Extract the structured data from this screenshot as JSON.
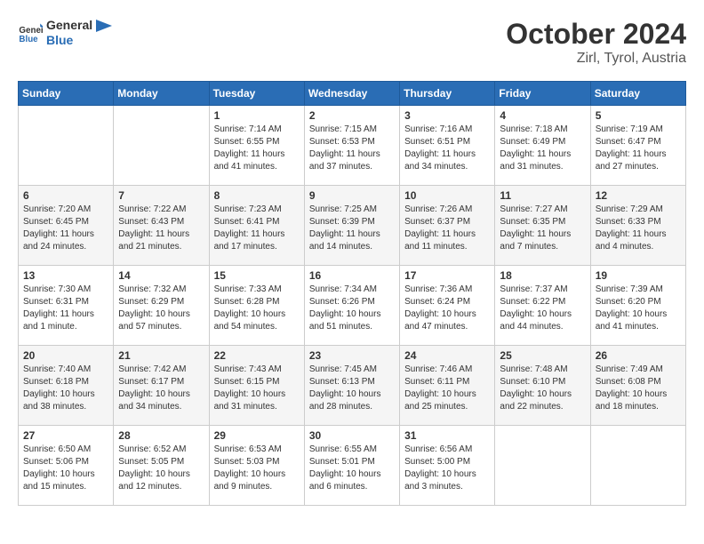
{
  "logo": {
    "line1": "General",
    "line2": "Blue"
  },
  "title": "October 2024",
  "subtitle": "Zirl, Tyrol, Austria",
  "header_days": [
    "Sunday",
    "Monday",
    "Tuesday",
    "Wednesday",
    "Thursday",
    "Friday",
    "Saturday"
  ],
  "weeks": [
    [
      {
        "day": "",
        "info": ""
      },
      {
        "day": "",
        "info": ""
      },
      {
        "day": "1",
        "info": "Sunrise: 7:14 AM\nSunset: 6:55 PM\nDaylight: 11 hours and 41 minutes."
      },
      {
        "day": "2",
        "info": "Sunrise: 7:15 AM\nSunset: 6:53 PM\nDaylight: 11 hours and 37 minutes."
      },
      {
        "day": "3",
        "info": "Sunrise: 7:16 AM\nSunset: 6:51 PM\nDaylight: 11 hours and 34 minutes."
      },
      {
        "day": "4",
        "info": "Sunrise: 7:18 AM\nSunset: 6:49 PM\nDaylight: 11 hours and 31 minutes."
      },
      {
        "day": "5",
        "info": "Sunrise: 7:19 AM\nSunset: 6:47 PM\nDaylight: 11 hours and 27 minutes."
      }
    ],
    [
      {
        "day": "6",
        "info": "Sunrise: 7:20 AM\nSunset: 6:45 PM\nDaylight: 11 hours and 24 minutes."
      },
      {
        "day": "7",
        "info": "Sunrise: 7:22 AM\nSunset: 6:43 PM\nDaylight: 11 hours and 21 minutes."
      },
      {
        "day": "8",
        "info": "Sunrise: 7:23 AM\nSunset: 6:41 PM\nDaylight: 11 hours and 17 minutes."
      },
      {
        "day": "9",
        "info": "Sunrise: 7:25 AM\nSunset: 6:39 PM\nDaylight: 11 hours and 14 minutes."
      },
      {
        "day": "10",
        "info": "Sunrise: 7:26 AM\nSunset: 6:37 PM\nDaylight: 11 hours and 11 minutes."
      },
      {
        "day": "11",
        "info": "Sunrise: 7:27 AM\nSunset: 6:35 PM\nDaylight: 11 hours and 7 minutes."
      },
      {
        "day": "12",
        "info": "Sunrise: 7:29 AM\nSunset: 6:33 PM\nDaylight: 11 hours and 4 minutes."
      }
    ],
    [
      {
        "day": "13",
        "info": "Sunrise: 7:30 AM\nSunset: 6:31 PM\nDaylight: 11 hours and 1 minute."
      },
      {
        "day": "14",
        "info": "Sunrise: 7:32 AM\nSunset: 6:29 PM\nDaylight: 10 hours and 57 minutes."
      },
      {
        "day": "15",
        "info": "Sunrise: 7:33 AM\nSunset: 6:28 PM\nDaylight: 10 hours and 54 minutes."
      },
      {
        "day": "16",
        "info": "Sunrise: 7:34 AM\nSunset: 6:26 PM\nDaylight: 10 hours and 51 minutes."
      },
      {
        "day": "17",
        "info": "Sunrise: 7:36 AM\nSunset: 6:24 PM\nDaylight: 10 hours and 47 minutes."
      },
      {
        "day": "18",
        "info": "Sunrise: 7:37 AM\nSunset: 6:22 PM\nDaylight: 10 hours and 44 minutes."
      },
      {
        "day": "19",
        "info": "Sunrise: 7:39 AM\nSunset: 6:20 PM\nDaylight: 10 hours and 41 minutes."
      }
    ],
    [
      {
        "day": "20",
        "info": "Sunrise: 7:40 AM\nSunset: 6:18 PM\nDaylight: 10 hours and 38 minutes."
      },
      {
        "day": "21",
        "info": "Sunrise: 7:42 AM\nSunset: 6:17 PM\nDaylight: 10 hours and 34 minutes."
      },
      {
        "day": "22",
        "info": "Sunrise: 7:43 AM\nSunset: 6:15 PM\nDaylight: 10 hours and 31 minutes."
      },
      {
        "day": "23",
        "info": "Sunrise: 7:45 AM\nSunset: 6:13 PM\nDaylight: 10 hours and 28 minutes."
      },
      {
        "day": "24",
        "info": "Sunrise: 7:46 AM\nSunset: 6:11 PM\nDaylight: 10 hours and 25 minutes."
      },
      {
        "day": "25",
        "info": "Sunrise: 7:48 AM\nSunset: 6:10 PM\nDaylight: 10 hours and 22 minutes."
      },
      {
        "day": "26",
        "info": "Sunrise: 7:49 AM\nSunset: 6:08 PM\nDaylight: 10 hours and 18 minutes."
      }
    ],
    [
      {
        "day": "27",
        "info": "Sunrise: 6:50 AM\nSunset: 5:06 PM\nDaylight: 10 hours and 15 minutes."
      },
      {
        "day": "28",
        "info": "Sunrise: 6:52 AM\nSunset: 5:05 PM\nDaylight: 10 hours and 12 minutes."
      },
      {
        "day": "29",
        "info": "Sunrise: 6:53 AM\nSunset: 5:03 PM\nDaylight: 10 hours and 9 minutes."
      },
      {
        "day": "30",
        "info": "Sunrise: 6:55 AM\nSunset: 5:01 PM\nDaylight: 10 hours and 6 minutes."
      },
      {
        "day": "31",
        "info": "Sunrise: 6:56 AM\nSunset: 5:00 PM\nDaylight: 10 hours and 3 minutes."
      },
      {
        "day": "",
        "info": ""
      },
      {
        "day": "",
        "info": ""
      }
    ]
  ]
}
